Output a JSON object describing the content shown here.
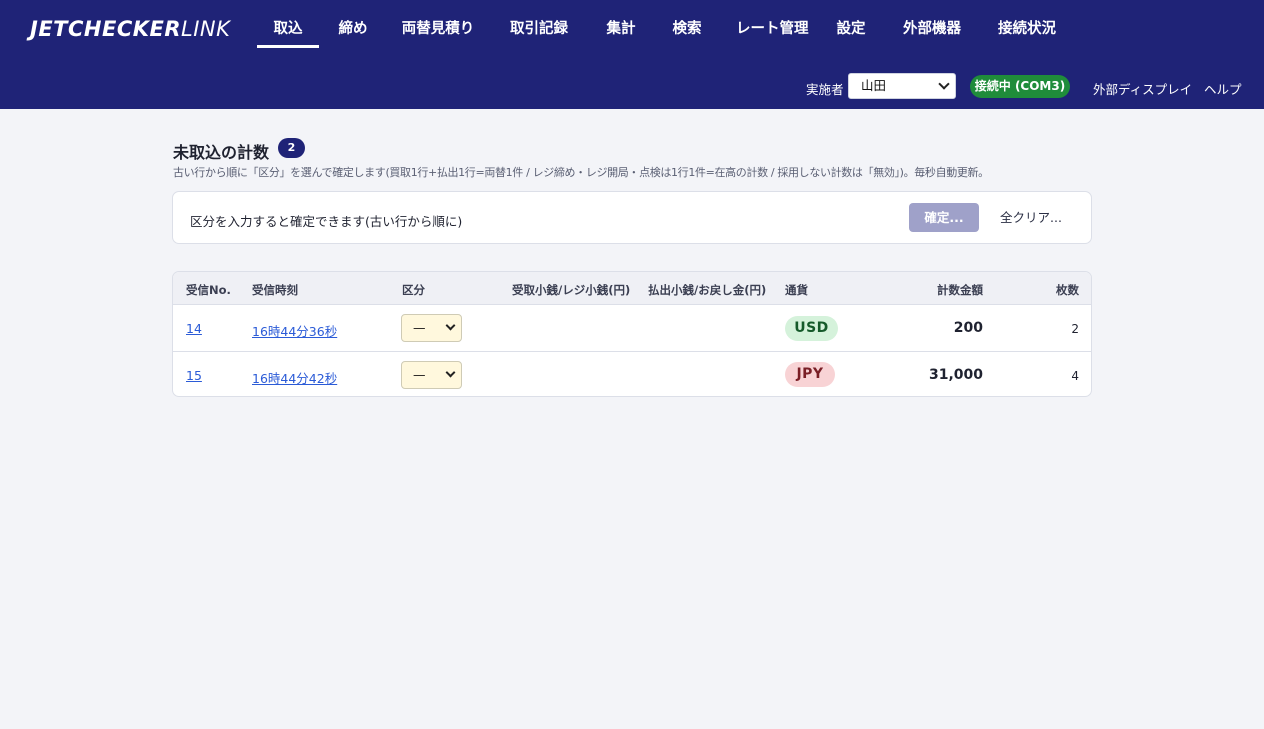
{
  "app": {
    "logo_part1": "JETCHECKER",
    "logo_part2": "LINK"
  },
  "nav": {
    "items": [
      {
        "label": "取込",
        "active": true
      },
      {
        "label": "締め"
      },
      {
        "label": "両替見積り"
      },
      {
        "label": "取引記録"
      },
      {
        "label": "集計"
      },
      {
        "label": "検索"
      },
      {
        "label": "レート管理"
      },
      {
        "label": "設定"
      },
      {
        "label": "外部機器"
      },
      {
        "label": "接続状況"
      }
    ]
  },
  "subbar": {
    "operator_label": "実施者",
    "operator_value": "山田",
    "connection_status": "接続中 (COM3)",
    "external_display": "外部ディスプレイ",
    "help": "ヘルプ"
  },
  "section": {
    "title": "未取込の計数",
    "count": "2",
    "description": "古い行から順に「区分」を選んで確定します(買取1行+払出1行=両替1件 / レジ締め・レジ開局・点検は1行1件=在高の計数 / 採用しない計数は「無効」)。毎秒自動更新。"
  },
  "action_card": {
    "message": "区分を入力すると確定できます(古い行から順に)",
    "confirm_label": "確定...",
    "clear_label": "全クリア..."
  },
  "table": {
    "headers": {
      "no": "受信No.",
      "time": "受信時刻",
      "kind": "区分",
      "received": "受取小銭/レジ小銭(円)",
      "paid": "払出小銭/お戻し金(円)",
      "currency": "通貨",
      "amount": "計数金額",
      "sheets": "枚数"
    },
    "rows": [
      {
        "no": "14",
        "time": "16時44分36秒",
        "kind": "—",
        "received": "",
        "paid": "",
        "currency": "USD",
        "amount": "200",
        "sheets": "2"
      },
      {
        "no": "15",
        "time": "16時44分42秒",
        "kind": "—",
        "received": "",
        "paid": "",
        "currency": "JPY",
        "amount": "31,000",
        "sheets": "4"
      }
    ]
  },
  "colors": {
    "header_bg": "#1f2377",
    "connected_green": "#1f8c3a",
    "usd_badge": "#d5f2db",
    "jpy_badge": "#f8d3d5",
    "link_blue": "#2b5bd7"
  }
}
